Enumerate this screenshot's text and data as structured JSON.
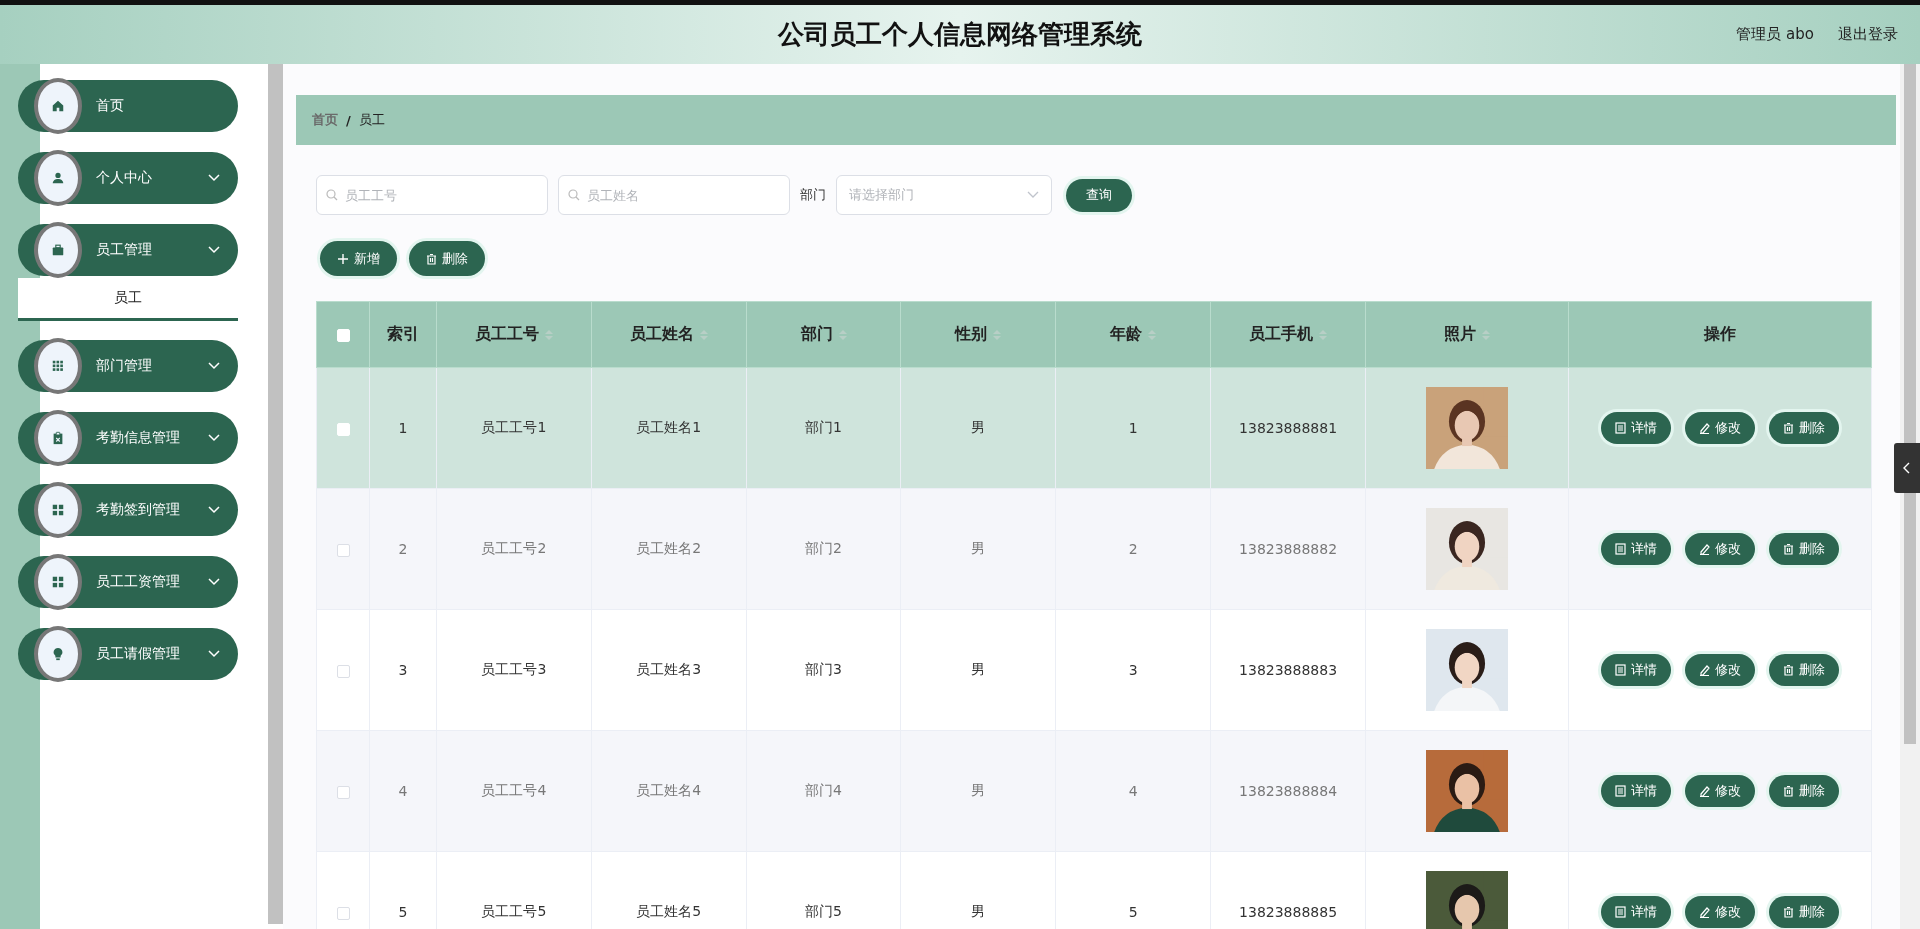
{
  "header": {
    "title": "公司员工个人信息网络管理系统",
    "user": "管理员 abo",
    "logout": "退出登录"
  },
  "sidebar": {
    "items": [
      {
        "label": "首页",
        "kind": "link"
      },
      {
        "label": "个人中心",
        "kind": "menu"
      },
      {
        "label": "员工管理",
        "kind": "menu",
        "children": [
          {
            "label": "员工",
            "selected": true
          }
        ]
      },
      {
        "label": "部门管理",
        "kind": "menu"
      },
      {
        "label": "考勤信息管理",
        "kind": "menu"
      },
      {
        "label": "考勤签到管理",
        "kind": "menu"
      },
      {
        "label": "员工工资管理",
        "kind": "menu"
      },
      {
        "label": "员工请假管理",
        "kind": "menu"
      }
    ]
  },
  "breadcrumb": {
    "items": [
      "首页",
      "员工"
    ],
    "separator": "/"
  },
  "search": {
    "fields": [
      {
        "placeholder": "员工工号"
      },
      {
        "placeholder": "员工姓名"
      }
    ],
    "department_label": "部门",
    "department_select": {
      "placeholder": "请选择部门"
    },
    "query_button": "查询"
  },
  "toolbar": [
    {
      "label": "新增",
      "kind": "add"
    },
    {
      "label": "删除",
      "kind": "delete"
    }
  ],
  "table": {
    "select_all": false,
    "columns": [
      {
        "label": "索引",
        "sortable": false
      },
      {
        "label": "员工工号",
        "sortable": true
      },
      {
        "label": "员工姓名",
        "sortable": true
      },
      {
        "label": "部门",
        "sortable": true
      },
      {
        "label": "性别",
        "sortable": true
      },
      {
        "label": "年龄",
        "sortable": true
      },
      {
        "label": "员工手机",
        "sortable": true
      },
      {
        "label": "照片",
        "sortable": true
      },
      {
        "label": "操作",
        "sortable": false
      }
    ],
    "rows": [
      {
        "selected": true,
        "checked": false,
        "cells": [
          "1",
          "员工工号1",
          "员工姓名1",
          "部门1",
          "男",
          "1",
          "13823888881"
        ],
        "photo": {
          "kind": "picture"
        },
        "actions": [
          "详情",
          "修改",
          "删除"
        ]
      },
      {
        "selected": false,
        "checked": false,
        "cells": [
          "2",
          "员工工号2",
          "员工姓名2",
          "部门2",
          "男",
          "2",
          "13823888882"
        ],
        "photo": {
          "kind": "picture"
        },
        "actions": [
          "详情",
          "修改",
          "删除"
        ]
      },
      {
        "selected": false,
        "checked": false,
        "cells": [
          "3",
          "员工工号3",
          "员工姓名3",
          "部门3",
          "男",
          "3",
          "13823888883"
        ],
        "photo": {
          "kind": "picture"
        },
        "actions": [
          "详情",
          "修改",
          "删除"
        ]
      },
      {
        "selected": false,
        "checked": false,
        "cells": [
          "4",
          "员工工号4",
          "员工姓名4",
          "部门4",
          "男",
          "4",
          "13823888884"
        ],
        "photo": {
          "kind": "picture"
        },
        "actions": [
          "详情",
          "修改",
          "删除"
        ]
      },
      {
        "selected": false,
        "checked": false,
        "cells": [
          "5",
          "员工工号5",
          "员工姓名5",
          "部门5",
          "男",
          "5",
          "13823888885"
        ],
        "photo": {
          "kind": "picture"
        },
        "actions": [
          "详情",
          "修改",
          "删除"
        ]
      }
    ]
  }
}
